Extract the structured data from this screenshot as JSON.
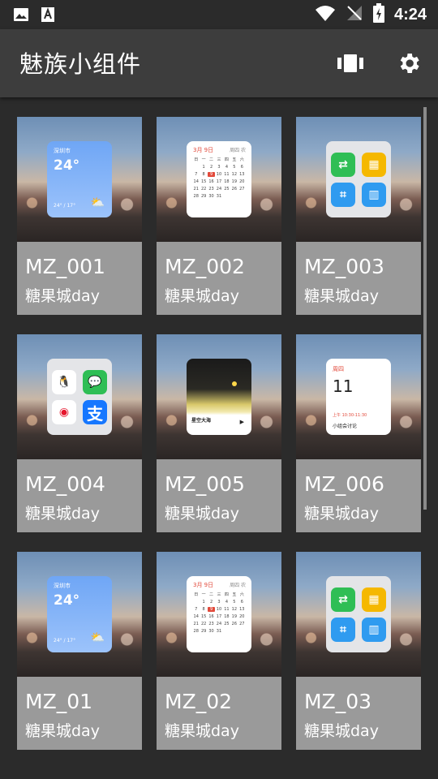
{
  "status": {
    "time": "4:24"
  },
  "header": {
    "title": "魅族小组件"
  },
  "icons": {
    "gallery": "image-icon",
    "font": "font-icon",
    "wifi": "wifi-icon",
    "signal": "no-signal-icon",
    "battery": "battery-charging-icon",
    "widgets": "widgets-icon",
    "settings": "gear-icon"
  },
  "colors": {
    "toolbar": "#3d3d3d",
    "background": "#2b2b2b",
    "card": "#9a9a9a"
  },
  "cards": [
    {
      "name": "MZ_001",
      "sub": "糖果城day",
      "widget": "weather"
    },
    {
      "name": "MZ_002",
      "sub": "糖果城day",
      "widget": "calendar"
    },
    {
      "name": "MZ_003",
      "sub": "糖果城day",
      "widget": "apps-wechat"
    },
    {
      "name": "MZ_004",
      "sub": "糖果城day",
      "widget": "apps-social"
    },
    {
      "name": "MZ_005",
      "sub": "糖果城day",
      "widget": "music"
    },
    {
      "name": "MZ_006",
      "sub": "糖果城day",
      "widget": "notes"
    },
    {
      "name": "MZ_01",
      "sub": "糖果城day",
      "widget": "weather"
    },
    {
      "name": "MZ_02",
      "sub": "糖果城day",
      "widget": "calendar"
    },
    {
      "name": "MZ_03",
      "sub": "糖果城day",
      "widget": "apps-wechat"
    }
  ],
  "weather_widget": {
    "city": "深圳市",
    "temp": "24°",
    "range": "24° / 17°"
  },
  "calendar_widget": {
    "month": "3月 9日",
    "right": "周四 农"
  },
  "music_widget": {
    "song": "星空大海"
  },
  "notes_widget": {
    "label": "周四",
    "day": "11",
    "time": "上午 10:30-11:30",
    "title": "小组会讨论"
  }
}
